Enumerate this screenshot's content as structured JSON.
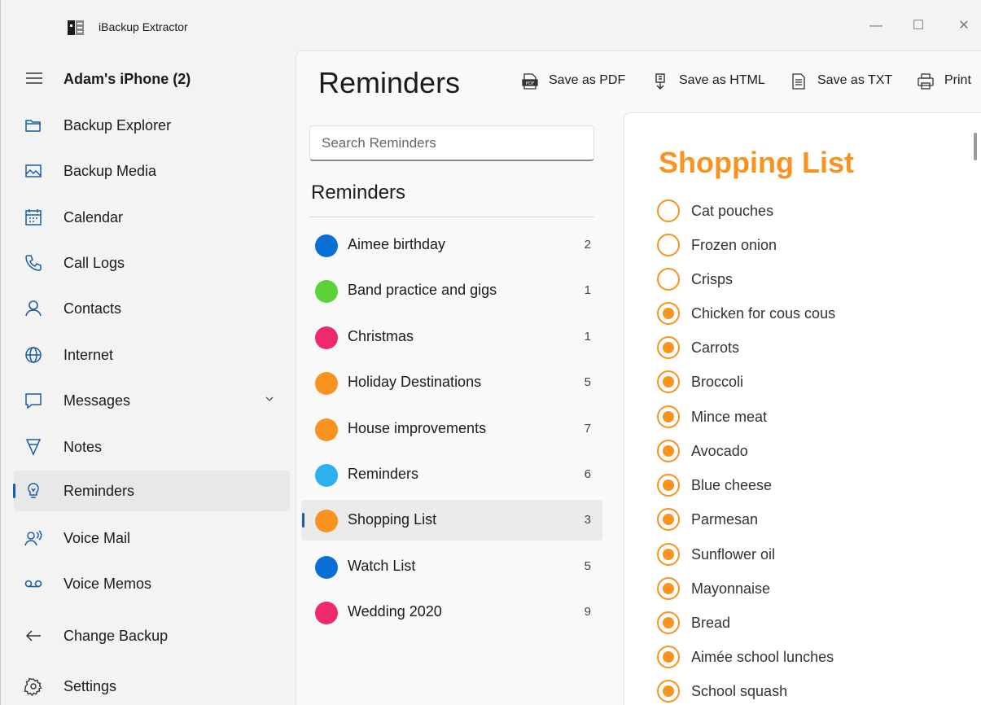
{
  "window": {
    "title": "iBackup Extractor",
    "controls": {
      "minimize": "—",
      "maximize": "☐",
      "close": "✕"
    }
  },
  "sidebar": {
    "device": "Adam's iPhone (2)",
    "items": [
      {
        "label": "Backup Explorer",
        "icon": "folder-icon"
      },
      {
        "label": "Backup Media",
        "icon": "image-icon"
      },
      {
        "label": "Calendar",
        "icon": "calendar-icon"
      },
      {
        "label": "Call Logs",
        "icon": "phone-icon"
      },
      {
        "label": "Contacts",
        "icon": "person-icon"
      },
      {
        "label": "Internet",
        "icon": "globe-icon"
      },
      {
        "label": "Messages",
        "icon": "message-icon"
      },
      {
        "label": "Notes",
        "icon": "notes-icon"
      },
      {
        "label": "Reminders",
        "icon": "lightbulb-icon"
      },
      {
        "label": "Voice Mail",
        "icon": "voicemail-person-icon"
      },
      {
        "label": "Voice Memos",
        "icon": "voicemail-icon"
      }
    ],
    "footer": [
      {
        "label": "Change Backup",
        "icon": "back-arrow-icon"
      },
      {
        "label": "Settings",
        "icon": "gear-icon"
      }
    ],
    "active_item": "Reminders"
  },
  "main": {
    "title": "Reminders",
    "toolbar": {
      "save_pdf": "Save as PDF",
      "save_html": "Save as HTML",
      "save_txt": "Save as TXT",
      "print": "Print"
    },
    "search": {
      "placeholder": "Search Reminders",
      "value": ""
    },
    "lists_heading": "Reminders",
    "lists": [
      {
        "name": "Aimee birthday",
        "count": "2",
        "color": "#0a6fd4"
      },
      {
        "name": "Band practice and gigs",
        "count": "1",
        "color": "#5cd13a"
      },
      {
        "name": "Christmas",
        "count": "1",
        "color": "#ee2a6a"
      },
      {
        "name": "Holiday Destinations",
        "count": "5",
        "color": "#f7931e"
      },
      {
        "name": "House improvements",
        "count": "7",
        "color": "#f7931e"
      },
      {
        "name": "Reminders",
        "count": "6",
        "color": "#2cb0f0"
      },
      {
        "name": "Shopping List",
        "count": "3",
        "color": "#f7931e"
      },
      {
        "name": "Watch List",
        "count": "5",
        "color": "#0a6fd4"
      },
      {
        "name": "Wedding 2020",
        "count": "9",
        "color": "#ee2a6a"
      }
    ],
    "selected_list": "Shopping List"
  },
  "detail": {
    "title": "Shopping List",
    "accent_color": "#f7931e",
    "items": [
      {
        "label": "Cat pouches",
        "completed": false
      },
      {
        "label": "Frozen onion",
        "completed": false
      },
      {
        "label": "Crisps",
        "completed": false
      },
      {
        "label": "Chicken for cous cous",
        "completed": true
      },
      {
        "label": "Carrots",
        "completed": true
      },
      {
        "label": "Broccoli",
        "completed": true
      },
      {
        "label": "Mince meat",
        "completed": true
      },
      {
        "label": "Avocado",
        "completed": true
      },
      {
        "label": "Blue cheese",
        "completed": true
      },
      {
        "label": "Parmesan",
        "completed": true
      },
      {
        "label": "Sunflower oil",
        "completed": true
      },
      {
        "label": "Mayonnaise",
        "completed": true
      },
      {
        "label": "Bread",
        "completed": true
      },
      {
        "label": "Aimée school lunches",
        "completed": true
      },
      {
        "label": "School squash",
        "completed": true
      }
    ]
  }
}
